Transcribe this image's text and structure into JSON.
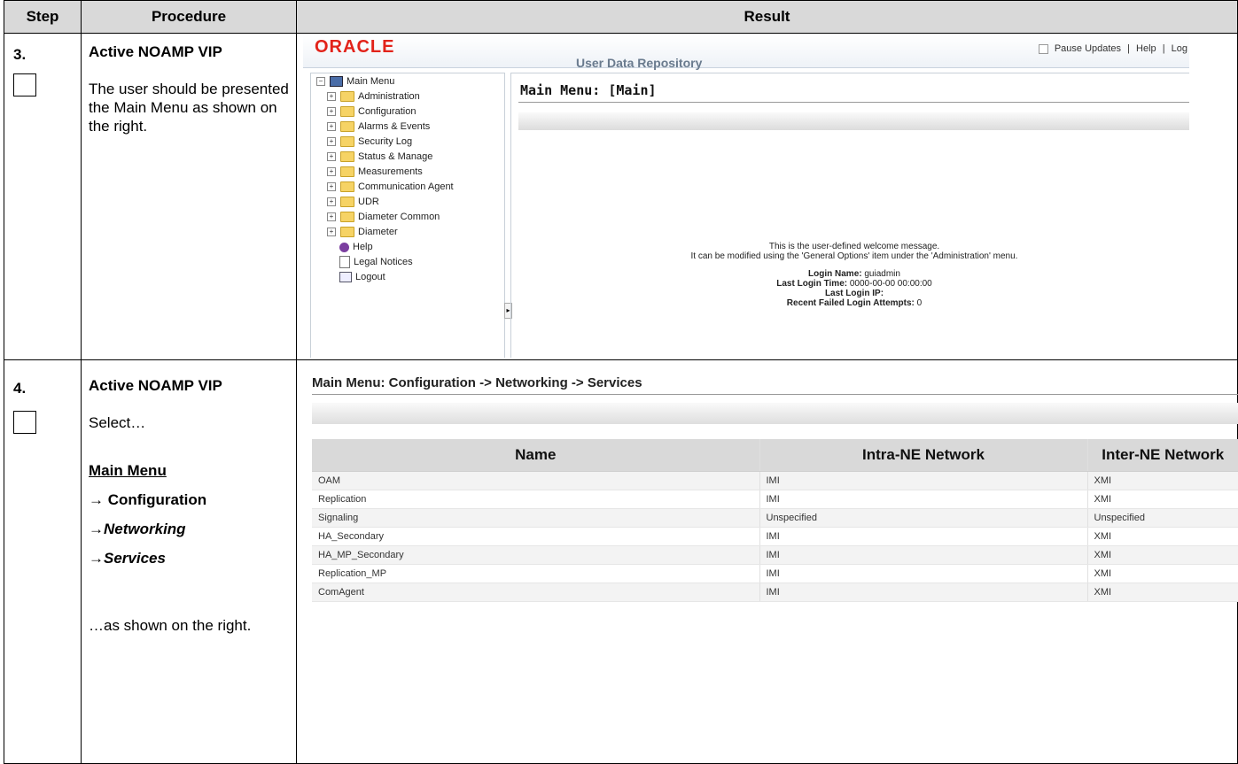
{
  "headers": {
    "step": "Step",
    "procedure": "Procedure",
    "result": "Result"
  },
  "step3": {
    "number": "3.",
    "title": "Active NOAMP VIP",
    "description": "The user should be presented the Main Menu as shown on the right.",
    "screenshot": {
      "logo": "ORACLE",
      "app_title": "User Data Repository",
      "pause_updates": "Pause Updates",
      "help": "Help",
      "logout_short": "Log",
      "page_title": "Main Menu: [Main]",
      "tree": {
        "root": "Main Menu",
        "items": [
          "Administration",
          "Configuration",
          "Alarms & Events",
          "Security Log",
          "Status & Manage",
          "Measurements",
          "Communication Agent",
          "UDR",
          "Diameter Common",
          "Diameter"
        ],
        "leaves": [
          "Help",
          "Legal Notices",
          "Logout"
        ]
      },
      "welcome_line1": "This is the user-defined welcome message.",
      "welcome_line2": "It can be modified using the 'General Options' item under the 'Administration' menu.",
      "login_name_label": "Login Name:",
      "login_name": "guiadmin",
      "last_login_time_label": "Last Login Time:",
      "last_login_time": "0000-00-00 00:00:00",
      "last_login_ip_label": "Last Login IP:",
      "last_login_ip": "",
      "failed_attempts_label": "Recent Failed Login Attempts:",
      "failed_attempts": "0"
    }
  },
  "step4": {
    "number": "4.",
    "title": "Active NOAMP VIP",
    "select": "Select…",
    "path_main": "Main Menu",
    "path_config": "→ Configuration",
    "path_networking": "→Networking",
    "path_services": "→Services",
    "suffix": "…as shown on the right.",
    "screenshot": {
      "page_title": "Main Menu: Configuration -> Networking -> Services",
      "columns": [
        "Name",
        "Intra-NE Network",
        "Inter-NE Network"
      ],
      "rows": [
        [
          "OAM",
          "IMI",
          "XMI"
        ],
        [
          "Replication",
          "IMI",
          "XMI"
        ],
        [
          "Signaling",
          "Unspecified",
          "Unspecified"
        ],
        [
          "HA_Secondary",
          "IMI",
          "XMI"
        ],
        [
          "HA_MP_Secondary",
          "IMI",
          "XMI"
        ],
        [
          "Replication_MP",
          "IMI",
          "XMI"
        ],
        [
          "ComAgent",
          "IMI",
          "XMI"
        ]
      ]
    }
  }
}
